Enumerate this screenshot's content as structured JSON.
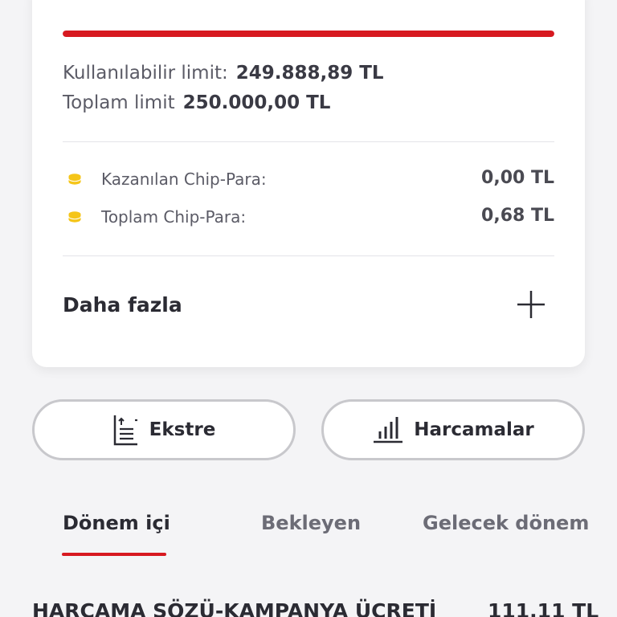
{
  "card": {
    "limit_usage_ratio": 1.0,
    "available_limit_label": "Kullanılabilir limit:",
    "available_limit_value": "249.888,89 TL",
    "total_limit_label": "Toplam limit",
    "total_limit_value": "250.000,00 TL",
    "chip_items": [
      {
        "label": "Kazanılan Chip-Para:",
        "value": "0,00 TL",
        "icon": "coin-icon"
      },
      {
        "label": "Toplam Chip-Para:",
        "value": "0,68 TL",
        "icon": "coin-icon"
      }
    ],
    "more_label": "Daha fazla",
    "more_icon": "plus-icon"
  },
  "actions": {
    "statement_label": "Ekstre",
    "statement_icon": "statement-icon",
    "spending_label": "Harcamalar",
    "spending_icon": "bar-chart-icon"
  },
  "tabs": [
    {
      "label": "Dönem içi",
      "active": true
    },
    {
      "label": "Bekleyen",
      "active": false
    },
    {
      "label": "Gelecek dönem",
      "active": false
    }
  ],
  "transactions": [
    {
      "title": "HARCAMA SÖZÜ-KAMPANYA ÜCRETİ",
      "amount": "111,11 TL"
    }
  ],
  "colors": {
    "accent": "#d71920",
    "coin": "#f5c518",
    "background": "#f4f4f6"
  }
}
